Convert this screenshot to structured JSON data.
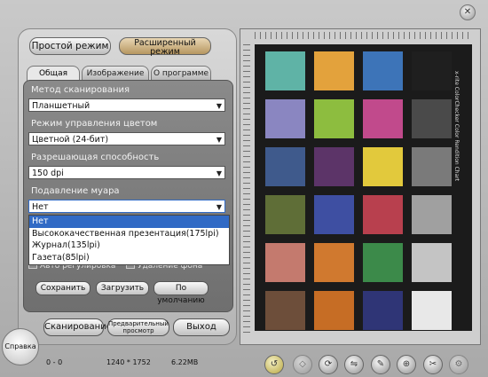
{
  "modes": {
    "simple": "Простой режим",
    "advanced_line1": "Расширенный",
    "advanced_line2": "режим"
  },
  "tabs": [
    "Общая",
    "Изображение",
    "О программе"
  ],
  "fields": {
    "scan_method": {
      "label": "Метод сканирования",
      "value": "Планшетный"
    },
    "color_mode": {
      "label": "Режим управления цветом",
      "value": "Цветной (24-бит)"
    },
    "resolution": {
      "label": "Разрешающая способность",
      "value": "150 dpi"
    },
    "moire": {
      "label": "Подавление муара",
      "value": "Нет",
      "options": [
        "Нет",
        "Высококачественная презентация(175lpi)",
        "Журнал(135lpi)",
        "Газета(85lpi)"
      ]
    }
  },
  "checkboxes": [
    "Авто регулировка",
    "Удаление фона"
  ],
  "buttons": {
    "save": "Сохранить",
    "load": "Загрузить",
    "default": "По умолчанию",
    "scan": "Сканирование",
    "preview_line1": "Предварительный",
    "preview_line2": "просмотр",
    "exit": "Выход",
    "help": "Справка"
  },
  "status": {
    "coords": "0 - 0",
    "size": "1240 * 1752",
    "filesize": "6.22MB"
  },
  "chart_label": "x-rite ColorChecker  Color Rendition Chart",
  "patch_colors": [
    "#5fb3a6",
    "#e3a23c",
    "#3d74b8",
    "#1f1f1f",
    "#8a86c1",
    "#8dbd3f",
    "#c14a8c",
    "#4a4a4a",
    "#3f5a8c",
    "#5c3468",
    "#e2c93c",
    "#7a7a7a",
    "#5f6e37",
    "#3e4fa2",
    "#b8404e",
    "#a0a0a0",
    "#c47a6e",
    "#d0792f",
    "#3c8a4a",
    "#c4c4c4",
    "#6d4e3a",
    "#c66d25",
    "#2f3576",
    "#e8e8e8"
  ]
}
